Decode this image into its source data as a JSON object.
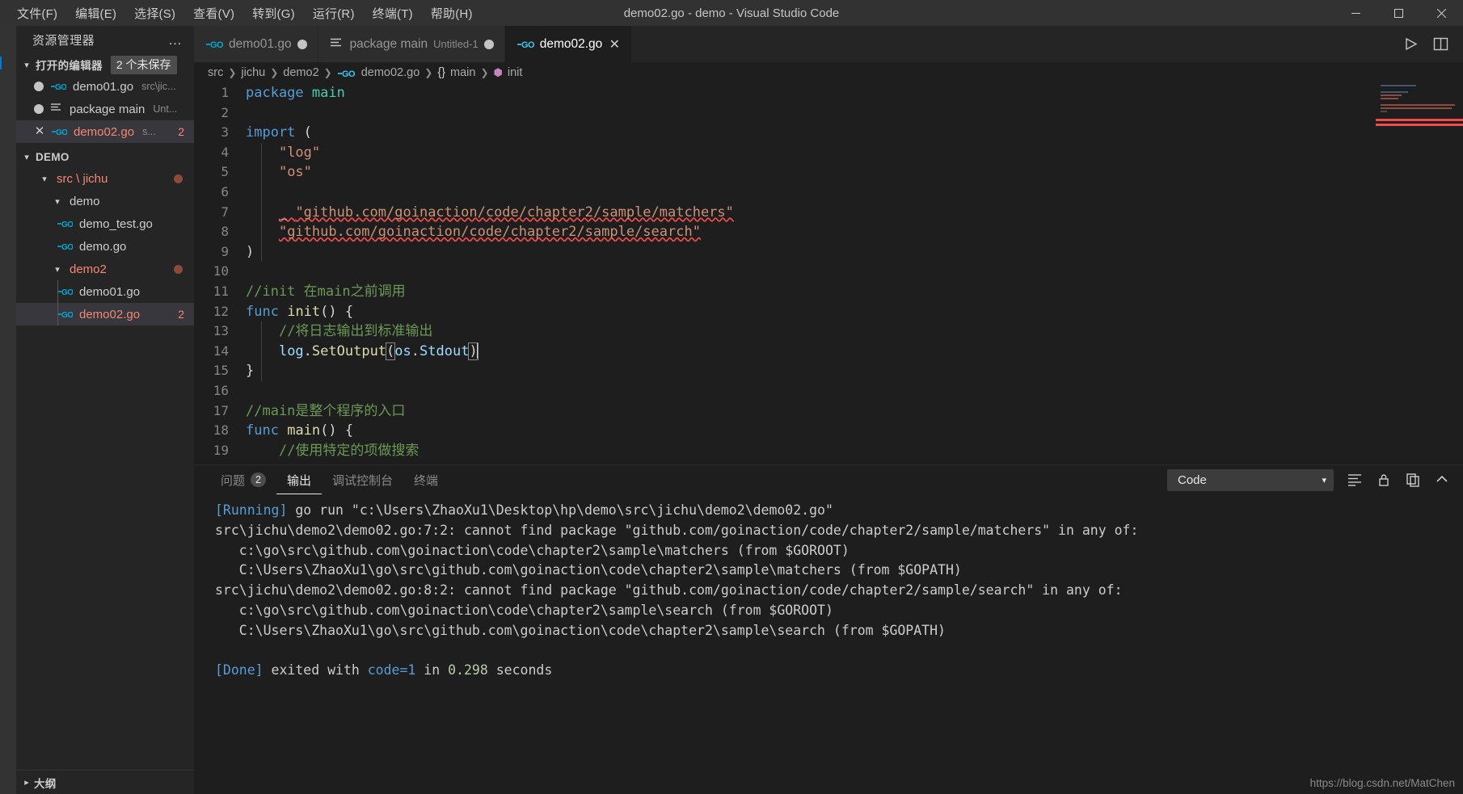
{
  "window": {
    "title": "demo02.go - demo - Visual Studio Code",
    "controls": {
      "minimize": "—",
      "maximize": "❐",
      "close": "✕"
    }
  },
  "menubar": [
    {
      "label": "文件(F)"
    },
    {
      "label": "编辑(E)"
    },
    {
      "label": "选择(S)"
    },
    {
      "label": "查看(V)"
    },
    {
      "label": "转到(G)"
    },
    {
      "label": "运行(R)"
    },
    {
      "label": "终端(T)"
    },
    {
      "label": "帮助(H)"
    }
  ],
  "sidebar": {
    "title": "资源管理器",
    "kebab": "…",
    "open_editors": {
      "label": "打开的编辑器",
      "badge": "2 个未保存",
      "items": [
        {
          "name": "demo01.go",
          "sub": "src\\jic...",
          "state": "dirty",
          "badge": ""
        },
        {
          "name": "package main",
          "sub": "Unt...",
          "state": "dirty",
          "badge": ""
        },
        {
          "name": "demo02.go",
          "sub": "s...",
          "state": "close",
          "badge": "2"
        }
      ]
    },
    "explorer": {
      "root": "DEMO",
      "tree": [
        {
          "name": "src \\ jichu",
          "kind": "folder",
          "error": true,
          "dot": true,
          "depth": 1
        },
        {
          "name": "demo",
          "kind": "folder",
          "error": false,
          "dot": false,
          "depth": 2
        },
        {
          "name": "demo_test.go",
          "kind": "go",
          "error": false,
          "dot": false,
          "depth": 3
        },
        {
          "name": "demo.go",
          "kind": "go",
          "error": false,
          "dot": false,
          "depth": 3
        },
        {
          "name": "demo2",
          "kind": "folder",
          "error": true,
          "dot": true,
          "depth": 2
        },
        {
          "name": "demo01.go",
          "kind": "go",
          "error": false,
          "dot": false,
          "depth": 3
        },
        {
          "name": "demo02.go",
          "kind": "go",
          "error": true,
          "dot": false,
          "depth": 3,
          "badge": "2",
          "selected": true
        }
      ]
    },
    "outline": {
      "label": "大纲"
    }
  },
  "tabs": [
    {
      "label": "demo01.go",
      "sub": "",
      "icon": "go-icon",
      "dirty": true,
      "active": false
    },
    {
      "label": "package main",
      "sub": "Untitled-1",
      "icon": "file-lines-icon",
      "dirty": true,
      "active": false
    },
    {
      "label": "demo02.go",
      "sub": "",
      "icon": "go-icon",
      "dirty": false,
      "active": true
    }
  ],
  "editor_actions": [
    {
      "name": "run-icon"
    },
    {
      "name": "split-editor-icon"
    }
  ],
  "breadcrumb": [
    "src",
    "jichu",
    "demo2",
    "demo02.go",
    "main",
    "init"
  ],
  "code": {
    "lines": [
      {
        "n": "1",
        "html": "<span class='kw'>package</span> <span class='pkgname'>main</span>"
      },
      {
        "n": "2",
        "html": ""
      },
      {
        "n": "3",
        "html": "<span class='kw'>import</span> <span class='plain'>(</span>"
      },
      {
        "n": "4",
        "html": "    <span class='str'>\"log\"</span>"
      },
      {
        "n": "5",
        "html": "    <span class='str'>\"os\"</span>"
      },
      {
        "n": "6",
        "html": ""
      },
      {
        "n": "7",
        "html": "    <span class='plain squiggle'>_ </span><span class='str squiggle'>\"github.com/goinaction/code/chapter2/sample/matchers\"</span>"
      },
      {
        "n": "8",
        "html": "    <span class='str squiggle'>\"github.com/goinaction/code/chapter2/sample/search\"</span>"
      },
      {
        "n": "9",
        "html": "<span class='plain'>)</span>"
      },
      {
        "n": "10",
        "html": ""
      },
      {
        "n": "11",
        "html": "<span class='cmt'>//init 在main之前调用</span>"
      },
      {
        "n": "12",
        "html": "<span class='kw'>func</span> <span class='fn'>init</span><span class='plain'>() {</span>"
      },
      {
        "n": "13",
        "html": "    <span class='cmt'>//将日志输出到标准输出</span>"
      },
      {
        "n": "14",
        "html": "    <span class='var'>log</span><span class='plain'>.</span><span class='fn'>SetOutput</span><span class='plain bracket-box'>(</span><span class='var'>os</span><span class='plain'>.</span><span class='var'>Stdout</span><span class='plain bracket-box'>)</span><span class='cursor'></span>"
      },
      {
        "n": "15",
        "html": "<span class='plain'>}</span>"
      },
      {
        "n": "16",
        "html": ""
      },
      {
        "n": "17",
        "html": "<span class='cmt'>//main是整个程序的入口</span>"
      },
      {
        "n": "18",
        "html": "<span class='kw'>func</span> <span class='fn'>main</span><span class='plain'>() {</span>"
      },
      {
        "n": "19",
        "html": "    <span class='cmt'>//使用特定的项做搜索</span>"
      }
    ]
  },
  "panel": {
    "tabs": [
      {
        "label": "问题",
        "badge": "2",
        "active": false
      },
      {
        "label": "输出",
        "badge": "",
        "active": true
      },
      {
        "label": "调试控制台",
        "badge": "",
        "active": false
      },
      {
        "label": "终端",
        "badge": "",
        "active": false
      }
    ],
    "channel_select": {
      "value": "Code",
      "chevron": "⌄"
    },
    "actions": [
      {
        "name": "clear-output-icon"
      },
      {
        "name": "lock-scroll-icon"
      },
      {
        "name": "open-in-editor-icon"
      },
      {
        "name": "collapse-panel-icon"
      }
    ],
    "output_lines": [
      {
        "html": "<span class='tag'>[Running]</span> <span class='warn'>go run \"c:\\Users\\ZhaoXu1\\Desktop\\hp\\demo\\src\\jichu\\demo2\\demo02.go\"</span>"
      },
      {
        "html": "src\\jichu\\demo2\\demo02.go:7:2: cannot find package \"github.com/goinaction/code/chapter2/sample/matchers\" in any of:"
      },
      {
        "html": "   c:\\go\\src\\github.com\\goinaction\\code\\chapter2\\sample\\matchers (from $GOROOT)"
      },
      {
        "html": "   C:\\Users\\ZhaoXu1\\go\\src\\github.com\\goinaction\\code\\chapter2\\sample\\matchers (from $GOPATH)"
      },
      {
        "html": "src\\jichu\\demo2\\demo02.go:8:2: cannot find package \"github.com/goinaction/code/chapter2/sample/search\" in any of:"
      },
      {
        "html": "   c:\\go\\src\\github.com\\goinaction\\code\\chapter2\\sample\\search (from $GOROOT)"
      },
      {
        "html": "   C:\\Users\\ZhaoXu1\\go\\src\\github.com\\goinaction\\code\\chapter2\\sample\\search (from $GOPATH)"
      },
      {
        "html": ""
      },
      {
        "html": "<span class='tag'>[Done]</span> exited with <span class='tag'>code=1</span> in <span class='num'>0.298</span> seconds"
      }
    ]
  },
  "watermark": "https://blog.csdn.net/MatChen",
  "colors": {
    "accent": "#007acc",
    "error": "#f48771",
    "squiggle": "#f14c4c",
    "keyword": "#569cd6",
    "string": "#ce9178",
    "comment": "#6a9955",
    "function": "#dcdcaa",
    "go_blue": "#00acd7"
  }
}
